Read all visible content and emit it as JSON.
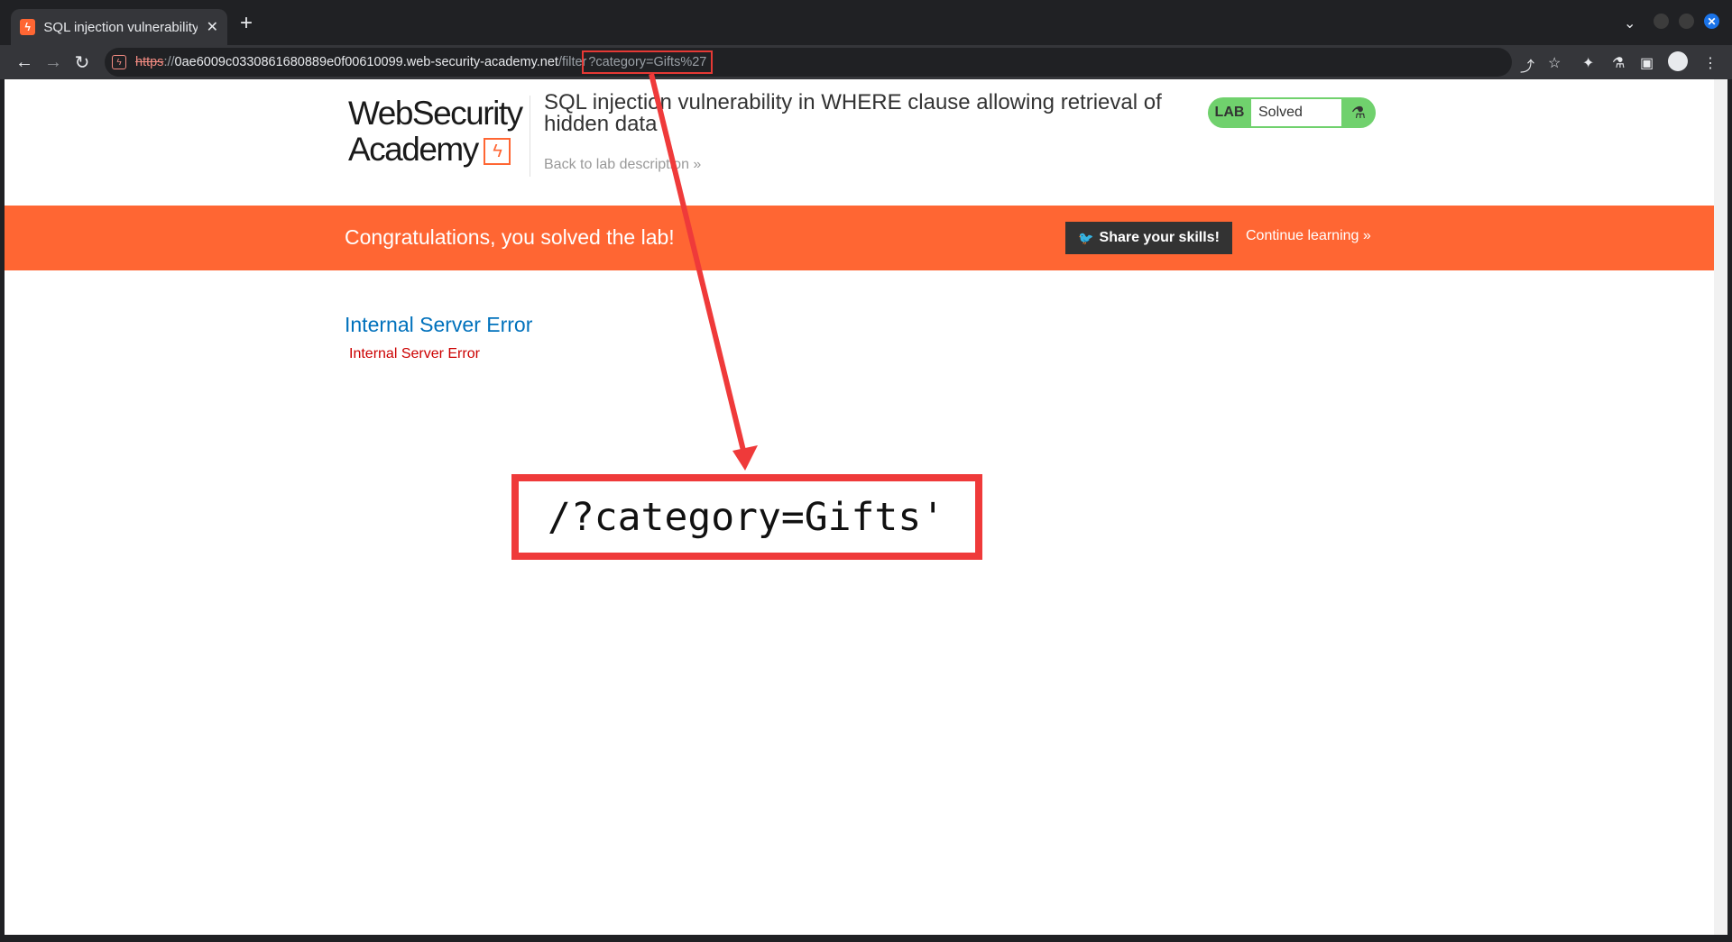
{
  "browser": {
    "tab": {
      "title": "SQL injection vulnerability",
      "favicon": "portswigger-icon"
    },
    "url": {
      "scheme": "https",
      "separator": "://",
      "host": "0ae6009c0330861680889e0f00610099.web-security-academy.net",
      "path": "/filter",
      "query": "?category=Gifts%27"
    }
  },
  "header": {
    "logo_line1": "WebSecurity",
    "logo_line2": "Academy",
    "logo_mark": "ϟ",
    "lab_title": "SQL injection vulnerability in WHERE clause allowing retrieval of hidden data",
    "back_link": "Back to lab description »",
    "lab_badge": {
      "label": "LAB",
      "status": "Solved",
      "icon": "flask-icon"
    }
  },
  "banner": {
    "message": "Congratulations, you solved the lab!",
    "share_label": "Share your skills!",
    "continue_label": "Continue learning »"
  },
  "content": {
    "error_heading": "Internal Server Error",
    "error_text": "Internal Server Error"
  },
  "annotation": {
    "text": "/?category=Gifts'"
  },
  "colors": {
    "accent": "#ff6633",
    "lab_solved": "#70d16d",
    "annotation": "#ef3a3a",
    "link_blue": "#0071bc",
    "error_red": "#cc0000"
  }
}
